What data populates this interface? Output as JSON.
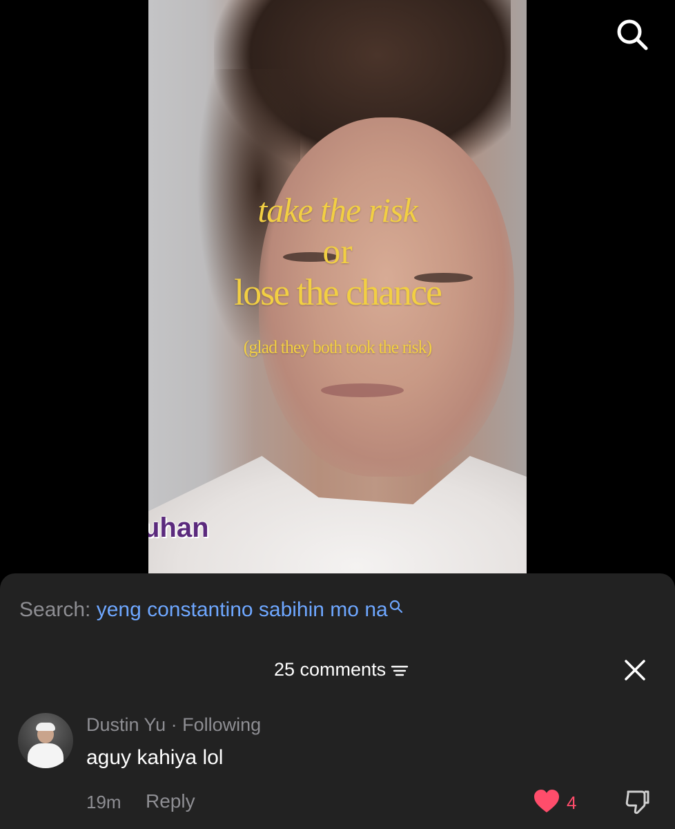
{
  "video": {
    "overlay_line1": "take the risk",
    "overlay_line2": "or",
    "overlay_line3": "lose the chance",
    "overlay_line4": "(glad they both took the risk)",
    "watermark": "uhan",
    "overlay_color": "#f2cf43"
  },
  "header": {
    "search_icon": "search-icon"
  },
  "search_suggestion": {
    "label": "Search:",
    "query": "yeng constantino sabihin mo na",
    "query_color": "#6ea7ff"
  },
  "comments": {
    "title": "25 comments",
    "sort_icon": "sort-icon",
    "close_icon": "close-icon",
    "items": [
      {
        "author": "Dustin Yu",
        "separator": "·",
        "relation": "Following",
        "text": "aguy kahiya lol",
        "time": "19m",
        "reply_label": "Reply",
        "likes": "4",
        "liked": true,
        "like_color": "#ff4d6b"
      }
    ]
  }
}
